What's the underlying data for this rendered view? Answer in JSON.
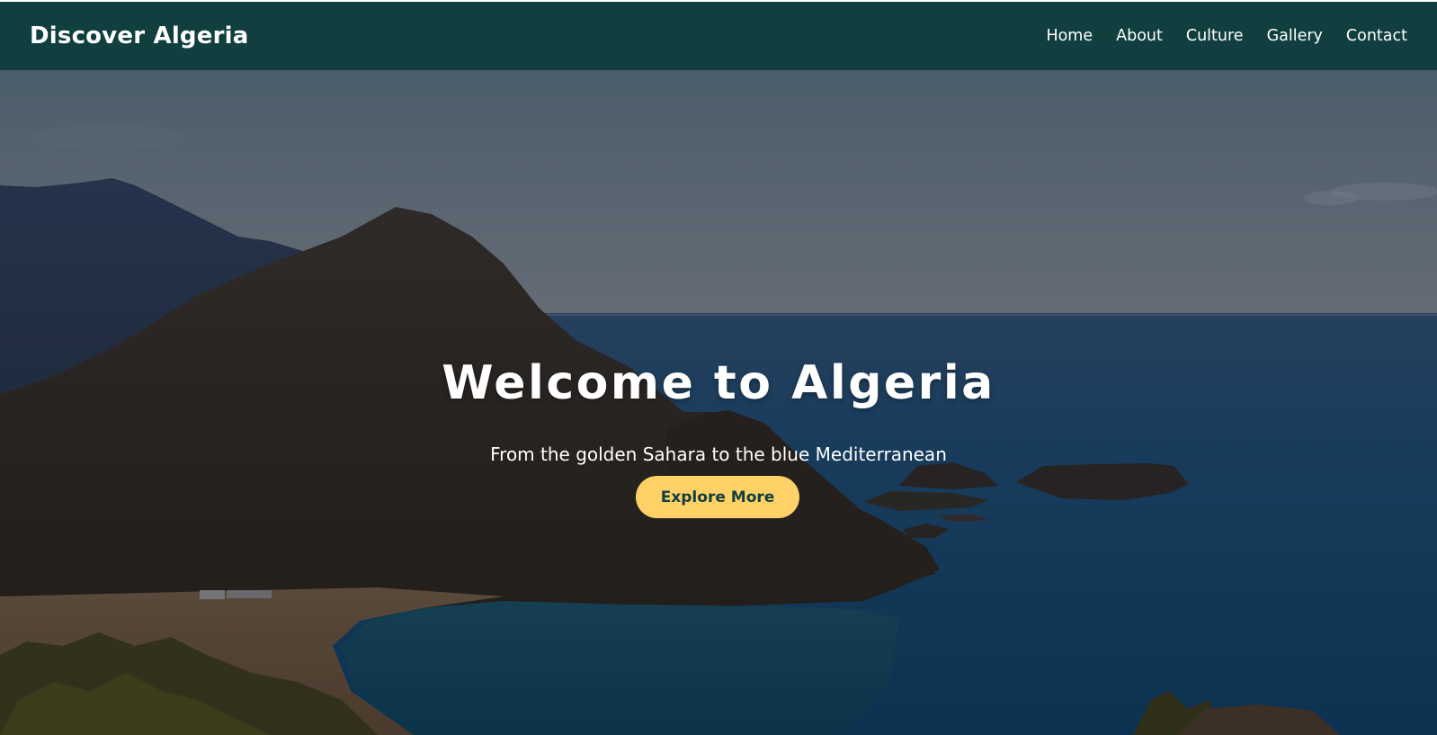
{
  "navbar": {
    "brand": "Discover Algeria",
    "links": [
      "Home",
      "About",
      "Culture",
      "Gallery",
      "Contact"
    ]
  },
  "hero": {
    "title": "Welcome to Algeria",
    "subtitle": "From the golden Sahara to the blue Mediterranean",
    "cta_label": "Explore More",
    "background_image": "coastal-mountain-landscape"
  },
  "colors": {
    "navbar_bg": "#113f40",
    "cta_bg": "#ffd166",
    "cta_text": "#113f40",
    "text": "#ffffff"
  }
}
